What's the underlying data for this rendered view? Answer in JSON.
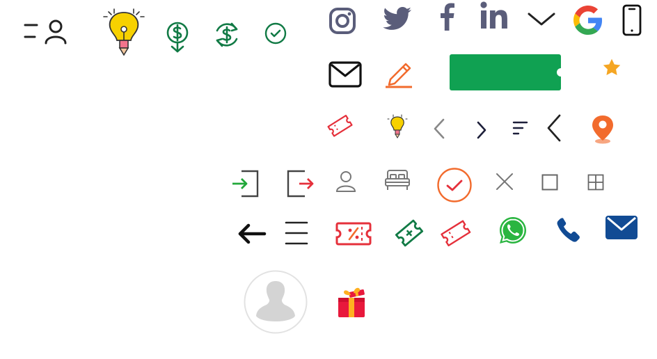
{
  "colors": {
    "dark": "#222222",
    "green": "#117a45",
    "bright_green": "#10a152",
    "social_gray": "#5a5d7a",
    "orange": "#f26b2d",
    "red": "#e5303b",
    "star": "#f5a623",
    "whatsapp": "#2ab540",
    "navy_blue": "#114b94",
    "light_gray": "#777777",
    "gift_red": "#e8193c",
    "gift_orange": "#ffb020"
  },
  "icons": [
    "menu-user-icon",
    "lightbulb-pencil-icon",
    "dollar-down-icon",
    "dollar-refresh-icon",
    "check-circle-icon",
    "instagram-icon",
    "twitter-icon",
    "facebook-icon",
    "linkedin-icon",
    "chevron-down-icon",
    "google-icon",
    "mobile-phone-icon",
    "envelope-icon",
    "edit-pencil-icon",
    "star-icon",
    "ticket-icon",
    "lightbulb-icon",
    "chevron-left-gray-icon",
    "chevron-right-icon",
    "sort-icon",
    "chevron-left-large-icon",
    "location-pin-icon",
    "login-icon",
    "logout-icon",
    "user-outline-icon",
    "bed-icon",
    "check-circle-orange-icon",
    "close-icon",
    "square-icon",
    "grid-icon",
    "arrow-left-icon",
    "hamburger-menu-icon",
    "discount-ticket-icon",
    "ticket-plus-icon",
    "ticket-outline-icon",
    "whatsapp-icon",
    "phone-icon",
    "mail-filled-icon",
    "avatar-placeholder-icon",
    "gift-icon"
  ]
}
